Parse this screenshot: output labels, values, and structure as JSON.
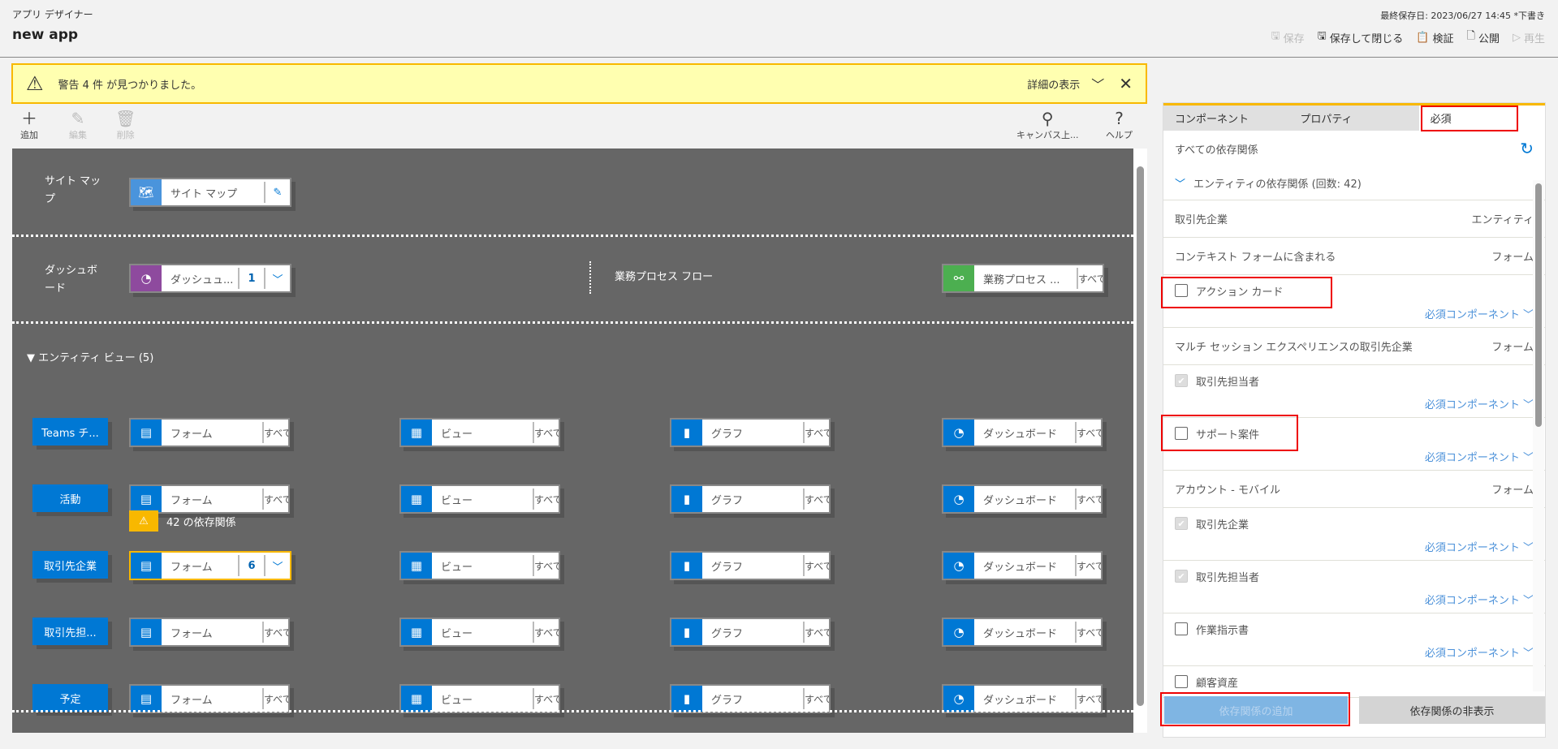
{
  "header": {
    "subtitle": "アプリ デザイナー",
    "title": "new app",
    "last_saved": "最終保存日: 2023/06/27 14:45 *下書き",
    "commands": [
      {
        "label": "保存",
        "icon": "save-icon",
        "enabled": false
      },
      {
        "label": "保存して閉じる",
        "icon": "save-close-icon",
        "enabled": true
      },
      {
        "label": "検証",
        "icon": "clipboard-icon",
        "enabled": true
      },
      {
        "label": "公開",
        "icon": "publish-icon",
        "enabled": true
      },
      {
        "label": "再生",
        "icon": "play-icon",
        "enabled": false
      }
    ]
  },
  "warning": {
    "message": "警告 4 件 が見つかりました。",
    "details": "詳細の表示",
    "color": "#f8b800"
  },
  "toolbar": {
    "add": "追加",
    "edit": "編集",
    "delete": "削除",
    "search": "キャンバス上...",
    "help": "ヘルプ"
  },
  "canvas": {
    "sitemap": {
      "label": "サイト マップ",
      "tile": "サイト マップ"
    },
    "dashboard": {
      "label": "ダッシュボード",
      "tile": "ダッシュュ...",
      "count": "1"
    },
    "bpf": {
      "label": "業務プロセス フロー",
      "tile": "業務プロセス ...",
      "all": "すべて"
    },
    "entity_view": "エンティティ ビュー (5)",
    "warning_badge": "42 の依存関係",
    "entities": [
      {
        "name": "Teams チ...",
        "form": "フォーム",
        "form_all": "すべて",
        "view": "ビュー",
        "chart": "グラフ",
        "dash": "ダッシュボード"
      },
      {
        "name": "活動",
        "form": "フォーム",
        "form_all": "すべて",
        "view": "ビュー",
        "chart": "グラフ",
        "dash": "ダッシュボード"
      },
      {
        "name": "取引先企業",
        "form": "フォーム",
        "form_count": "6",
        "view": "ビュー",
        "chart": "グラフ",
        "dash": "ダッシュボード"
      },
      {
        "name": "取引先担...",
        "form": "フォーム",
        "form_all": "すべて",
        "view": "ビュー",
        "chart": "グラフ",
        "dash": "ダッシュボード"
      },
      {
        "name": "予定",
        "form": "フォーム",
        "form_all": "すべて",
        "view": "ビュー",
        "chart": "グラフ",
        "dash": "ダッシュボード"
      }
    ],
    "all_label": "すべて"
  },
  "panel": {
    "tabs": [
      "コンポーネント",
      "プロパティ",
      "必須"
    ],
    "active_tab": 2,
    "all_deps": "すべての依存関係",
    "entity_deps": "エンティティの依存関係 (回数: 42)",
    "required_label": "必須コンポーネント",
    "rows": [
      {
        "type": "group",
        "label": "取引先企業",
        "kind": "エンティティ"
      },
      {
        "type": "group",
        "label": "コンテキスト フォームに含まれる",
        "kind": "フォーム"
      },
      {
        "type": "item",
        "label": "アクション カード",
        "checked": false,
        "disabled": false
      },
      {
        "type": "group",
        "label": "マルチ セッション エクスペリエンスの取引先企業",
        "kind": "フォーム"
      },
      {
        "type": "item",
        "label": "取引先担当者",
        "checked": true,
        "disabled": true
      },
      {
        "type": "item",
        "label": "サポート案件",
        "checked": false,
        "disabled": false
      },
      {
        "type": "group",
        "label": "アカウント - モバイル",
        "kind": "フォーム"
      },
      {
        "type": "item",
        "label": "取引先企業",
        "checked": true,
        "disabled": true
      },
      {
        "type": "item",
        "label": "取引先担当者",
        "checked": true,
        "disabled": true
      },
      {
        "type": "item",
        "label": "作業指示書",
        "checked": false,
        "disabled": false
      },
      {
        "type": "item",
        "label": "顧客資産",
        "checked": false,
        "disabled": false,
        "no_req": true
      }
    ],
    "add_button": "依存関係の追加",
    "hide_button": "依存関係の非表示"
  }
}
